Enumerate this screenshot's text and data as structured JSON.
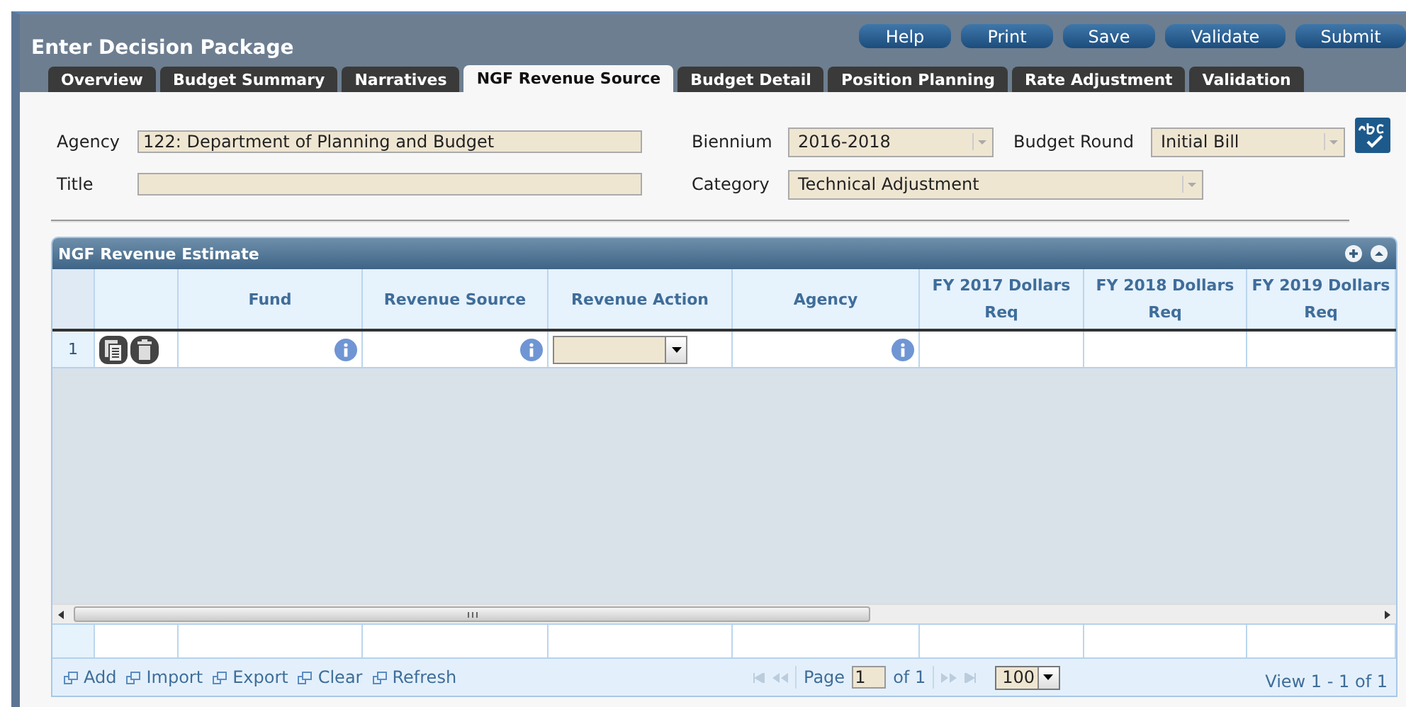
{
  "window": {
    "title": "Enter Decision Package"
  },
  "toolbar_buttons": [
    "Help",
    "Print",
    "Save",
    "Validate",
    "Submit"
  ],
  "tabs": [
    {
      "label": "Overview",
      "selected": false
    },
    {
      "label": "Budget Summary",
      "selected": false
    },
    {
      "label": "Narratives",
      "selected": false
    },
    {
      "label": "NGF Revenue Source",
      "selected": true
    },
    {
      "label": "Budget Detail",
      "selected": false
    },
    {
      "label": "Position Planning",
      "selected": false
    },
    {
      "label": "Rate Adjustment",
      "selected": false
    },
    {
      "label": "Validation",
      "selected": false
    }
  ],
  "form": {
    "agency": {
      "label": "Agency",
      "value": "122: Department of Planning and Budget"
    },
    "title": {
      "label": "Title"
    },
    "biennium": {
      "label": "Biennium",
      "value": "2016-2018"
    },
    "budget_round": {
      "label": "Budget Round",
      "value": "Initial Bill"
    },
    "category": {
      "label": "Category",
      "value": "Technical Adjustment"
    }
  },
  "grid": {
    "title": "NGF Revenue Estimate",
    "columns": [
      {
        "label": "Fund"
      },
      {
        "label": "Revenue Source"
      },
      {
        "label": "Revenue Action"
      },
      {
        "label": "Agency"
      },
      {
        "label": "FY 2017 Dollars Req"
      },
      {
        "label": "FY 2018 Dollars Req"
      },
      {
        "label": "FY 2019 Dollars Req"
      }
    ],
    "rows": [
      {
        "number": "1"
      }
    ],
    "actions": [
      "Add",
      "Import",
      "Export",
      "Clear",
      "Refresh"
    ],
    "pager": {
      "page_label": "Page",
      "page": "1",
      "of": "of 1",
      "page_size": "100",
      "view": "View 1 - 1 of 1"
    }
  }
}
